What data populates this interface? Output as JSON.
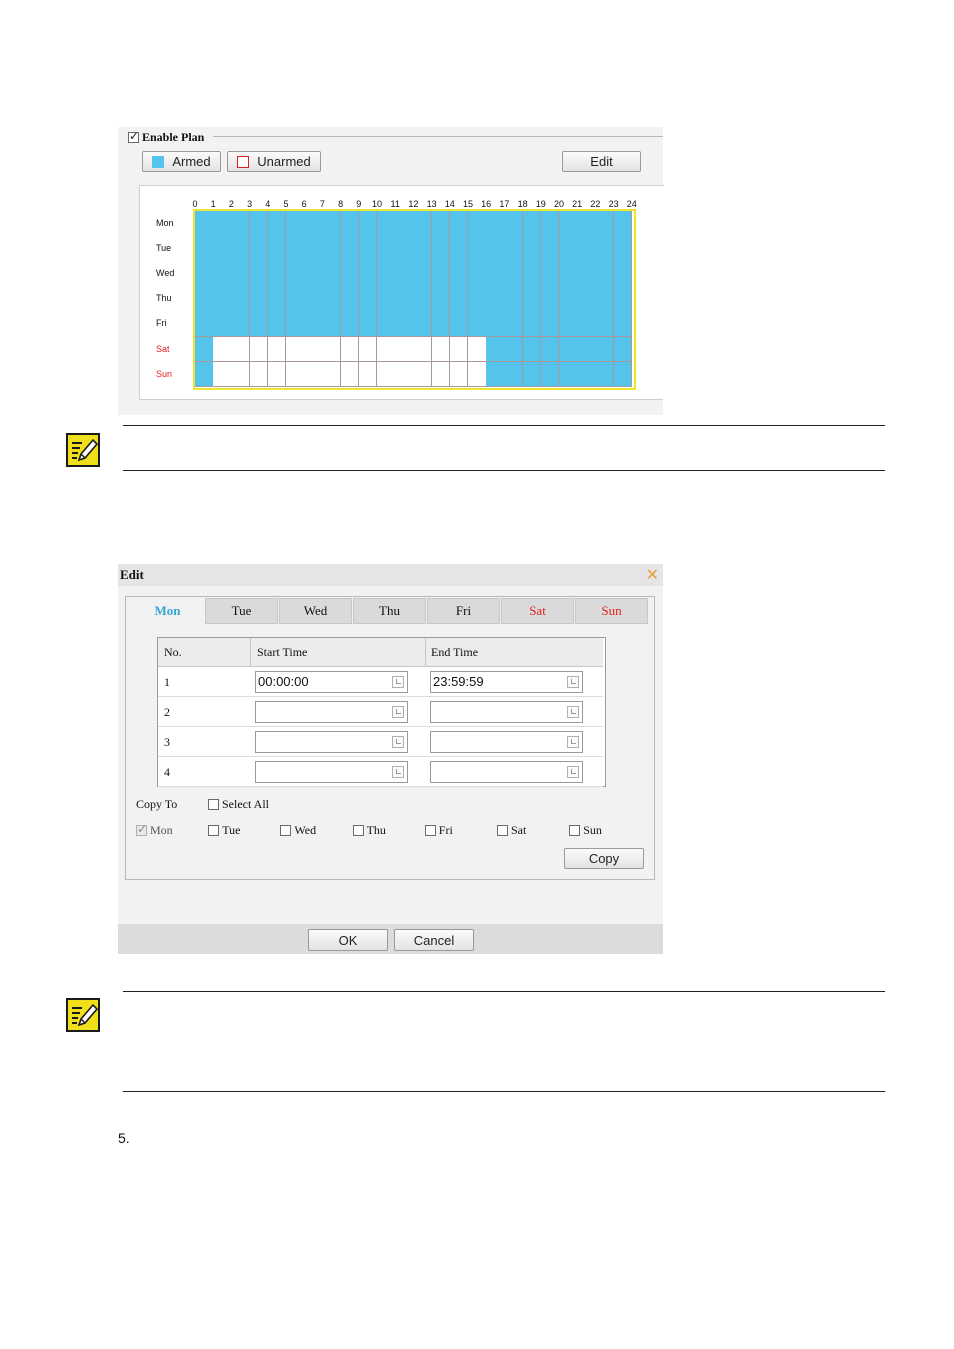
{
  "plan": {
    "enable_label": "Enable Plan",
    "enable_checked": true,
    "armed_label": "Armed",
    "unarmed_label": "Unarmed",
    "edit_label": "Edit",
    "hours": [
      "0",
      "1",
      "2",
      "3",
      "4",
      "5",
      "6",
      "7",
      "8",
      "9",
      "10",
      "11",
      "12",
      "13",
      "14",
      "15",
      "16",
      "17",
      "18",
      "19",
      "20",
      "21",
      "22",
      "23",
      "24"
    ],
    "days": [
      {
        "label": "Mon",
        "weekend": false,
        "armed": [
          [
            0,
            24
          ]
        ]
      },
      {
        "label": "Tue",
        "weekend": false,
        "armed": [
          [
            0,
            24
          ]
        ]
      },
      {
        "label": "Wed",
        "weekend": false,
        "armed": [
          [
            0,
            24
          ]
        ]
      },
      {
        "label": "Thu",
        "weekend": false,
        "armed": [
          [
            0,
            24
          ]
        ]
      },
      {
        "label": "Fri",
        "weekend": false,
        "armed": [
          [
            0,
            24
          ]
        ]
      },
      {
        "label": "Sat",
        "weekend": true,
        "armed": [
          [
            0,
            1
          ],
          [
            16,
            24
          ]
        ]
      },
      {
        "label": "Sun",
        "weekend": true,
        "armed": [
          [
            0,
            1
          ],
          [
            16,
            24
          ]
        ]
      }
    ],
    "colors": {
      "armed": "#55c4ed",
      "unarmed": "#ffffff",
      "weekend_text": "#e02020",
      "selection_border": "#ede52e"
    }
  },
  "edit_dialog": {
    "title": "Edit",
    "tabs": [
      {
        "label": "Mon",
        "active": true,
        "weekend": false
      },
      {
        "label": "Tue",
        "active": false,
        "weekend": false
      },
      {
        "label": "Wed",
        "active": false,
        "weekend": false
      },
      {
        "label": "Thu",
        "active": false,
        "weekend": false
      },
      {
        "label": "Fri",
        "active": false,
        "weekend": false
      },
      {
        "label": "Sat",
        "active": false,
        "weekend": true
      },
      {
        "label": "Sun",
        "active": false,
        "weekend": true
      }
    ],
    "table": {
      "headers": {
        "no": "No.",
        "start": "Start Time",
        "end": "End Time"
      },
      "rows": [
        {
          "no": "1",
          "start": "00:00:00",
          "end": "23:59:59"
        },
        {
          "no": "2",
          "start": "",
          "end": ""
        },
        {
          "no": "3",
          "start": "",
          "end": ""
        },
        {
          "no": "4",
          "start": "",
          "end": ""
        }
      ]
    },
    "copy_to_label": "Copy To",
    "select_all_label": "Select All",
    "copy_days": [
      {
        "label": "Mon",
        "checked": true,
        "disabled": true
      },
      {
        "label": "Tue",
        "checked": false,
        "disabled": false
      },
      {
        "label": "Wed",
        "checked": false,
        "disabled": false
      },
      {
        "label": "Thu",
        "checked": false,
        "disabled": false
      },
      {
        "label": "Fri",
        "checked": false,
        "disabled": false
      },
      {
        "label": "Sat",
        "checked": false,
        "disabled": false
      },
      {
        "label": "Sun",
        "checked": false,
        "disabled": false
      }
    ],
    "copy_button": "Copy",
    "ok_button": "OK",
    "cancel_button": "Cancel"
  },
  "step_number": "5."
}
